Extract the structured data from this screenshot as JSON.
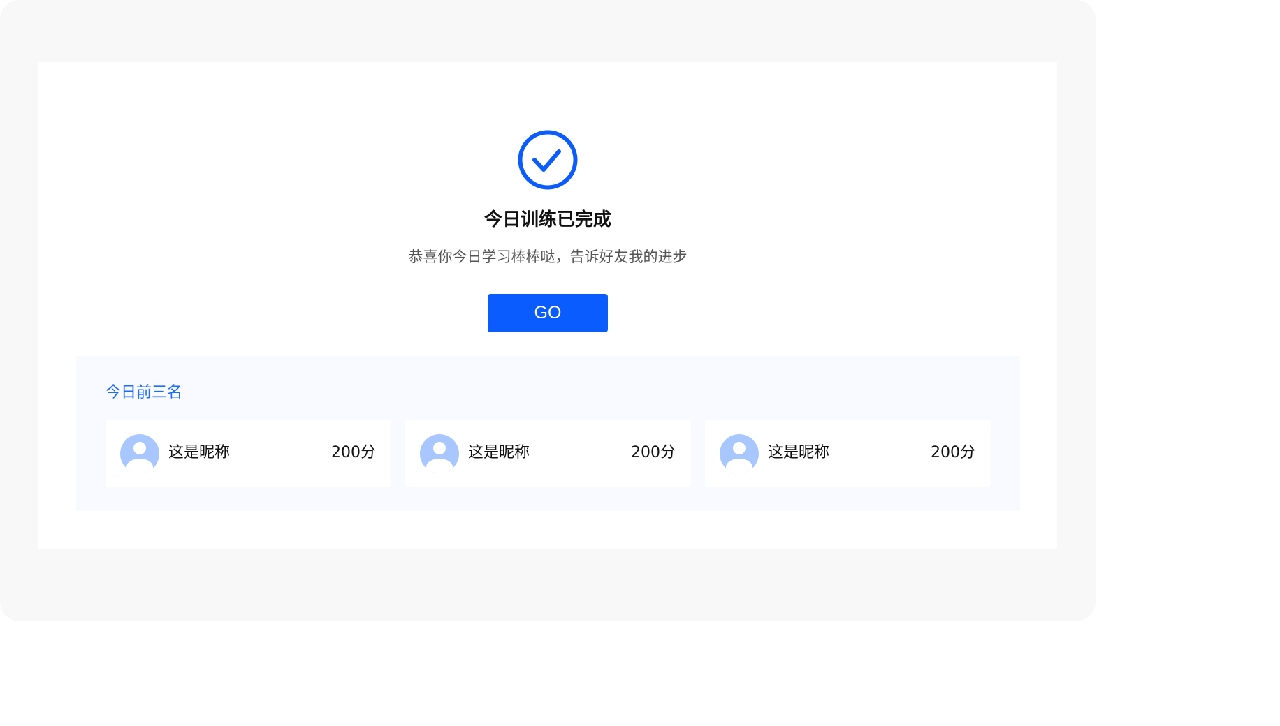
{
  "result": {
    "title": "今日训练已完成",
    "subtitle": "恭喜你今日学习棒棒哒，告诉好友我的进步",
    "button_label": "GO",
    "icon": "check-circle-icon"
  },
  "ranking": {
    "title": "今日前三名",
    "items": [
      {
        "nickname": "这是昵称",
        "score": "200分",
        "avatar": "user-avatar-icon"
      },
      {
        "nickname": "这是昵称",
        "score": "200分",
        "avatar": "user-avatar-icon"
      },
      {
        "nickname": "这是昵称",
        "score": "200分",
        "avatar": "user-avatar-icon"
      }
    ]
  },
  "colors": {
    "accent": "#0b5cff",
    "ranking_title": "#1a6bff",
    "avatar_fill": "#a8c6ff",
    "page_bg": "#f8f8f8",
    "panel_bg": "#f8faff"
  }
}
